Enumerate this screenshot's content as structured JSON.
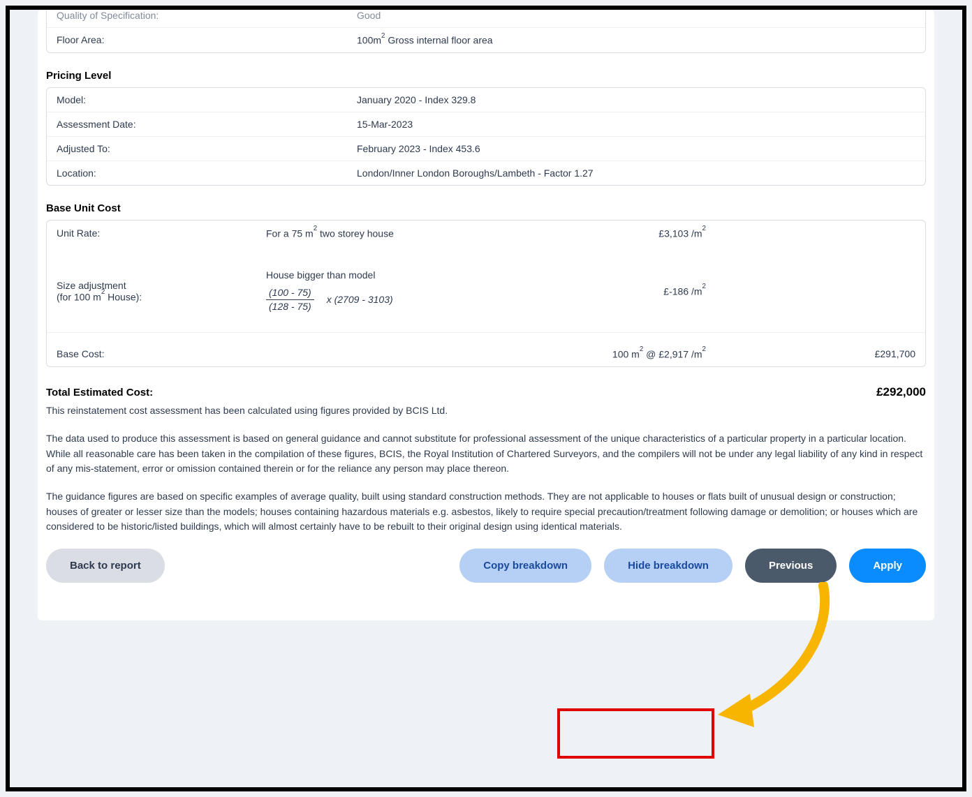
{
  "topOverflow": {
    "label": "Quality of Specification:",
    "value": "Good",
    "floorLabel": "Floor Area:",
    "floorValue_pre": "100m",
    "floorValue_post": " Gross internal floor area"
  },
  "pricingLevel": {
    "title": "Pricing Level",
    "rows": [
      {
        "label": "Model:",
        "value": "January 2020 - Index 329.8"
      },
      {
        "label": "Assessment Date:",
        "value": "15-Mar-2023"
      },
      {
        "label": "Adjusted To:",
        "value": "February 2023 - Index 453.6"
      },
      {
        "label": "Location:",
        "value": "London/Inner London Boroughs/Lambeth - Factor 1.27"
      }
    ]
  },
  "baseUnitCost": {
    "title": "Base Unit Cost",
    "unitRate": {
      "label": "Unit Rate:",
      "desc_pre": "For a 75 m",
      "desc_post": " two storey house",
      "price_pre": "£3,103 /m"
    },
    "sizeAdj": {
      "label_line1": "Size adjustment",
      "label_line2_pre": "(for 100 m",
      "label_line2_post": " House):",
      "note": "House bigger than model",
      "frac_top": "(100 - 75)",
      "frac_bot": "(128 - 75)",
      "multiplier": "x (2709 - 3103)",
      "price_pre": "£-186 /m"
    },
    "baseCost": {
      "label": "Base Cost:",
      "qty_pre": "100 m",
      "qty_mid": " @ £2,917 /m",
      "total": "£291,700"
    }
  },
  "total": {
    "label": "Total Estimated Cost:",
    "amount": "£292,000"
  },
  "paragraphs": {
    "p1": "This reinstatement cost assessment has been calculated using figures provided by BCIS Ltd.",
    "p2": "The data used to produce this assessment is based on general guidance and cannot substitute for professional assessment of the unique characteristics of a particular property in a particular location. While all reasonable care has been taken in the compilation of these figures, BCIS, the Royal Institution of Chartered Surveyors, and the compilers will not be under any legal liability of any kind in respect of any mis-statement, error or omission contained therein or for the reliance any person may place thereon.",
    "p3": "The guidance figures are based on specific examples of average quality, built using standard construction methods. They are not applicable to houses or flats built of unusual design or construction; houses of greater or lesser size than the models; houses containing hazardous materials e.g. asbestos, likely to require special precaution/treatment following damage or demolition; or houses which are considered to be historic/listed buildings, which will almost certainly have to be rebuilt to their original design using identical materials."
  },
  "buttons": {
    "back": "Back to report",
    "copy": "Copy breakdown",
    "hide": "Hide breakdown",
    "prev": "Previous",
    "apply": "Apply"
  }
}
